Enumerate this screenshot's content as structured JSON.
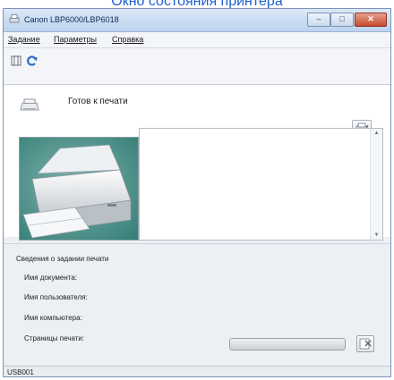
{
  "caption": "Окно состояния принтера",
  "window": {
    "title": "Canon LBP6000/LBP6018"
  },
  "title_controls": {
    "minimize": "–",
    "maximize": "□",
    "close": "✕"
  },
  "menu": [
    {
      "label": "Задание"
    },
    {
      "label": "Параметры"
    },
    {
      "label": "Справка"
    }
  ],
  "toolbar": {
    "icons": [
      "queue-icon",
      "refresh-icon"
    ]
  },
  "status": {
    "text": "Готов к печати",
    "icon": "printer-icon"
  },
  "job_info": {
    "title": "Сведения о задании печати",
    "document_name": "Имя документа:",
    "user_name": "Имя пользователя:",
    "computer_name": "Имя компьютера:",
    "pages_printed": "Страницы печати:"
  },
  "port": "USB001",
  "colors": {
    "caption": "#1f5fd0",
    "titlebar": "#bcd2ee",
    "close_button": "#c54a2c",
    "photo_background": "#3e8a82"
  }
}
